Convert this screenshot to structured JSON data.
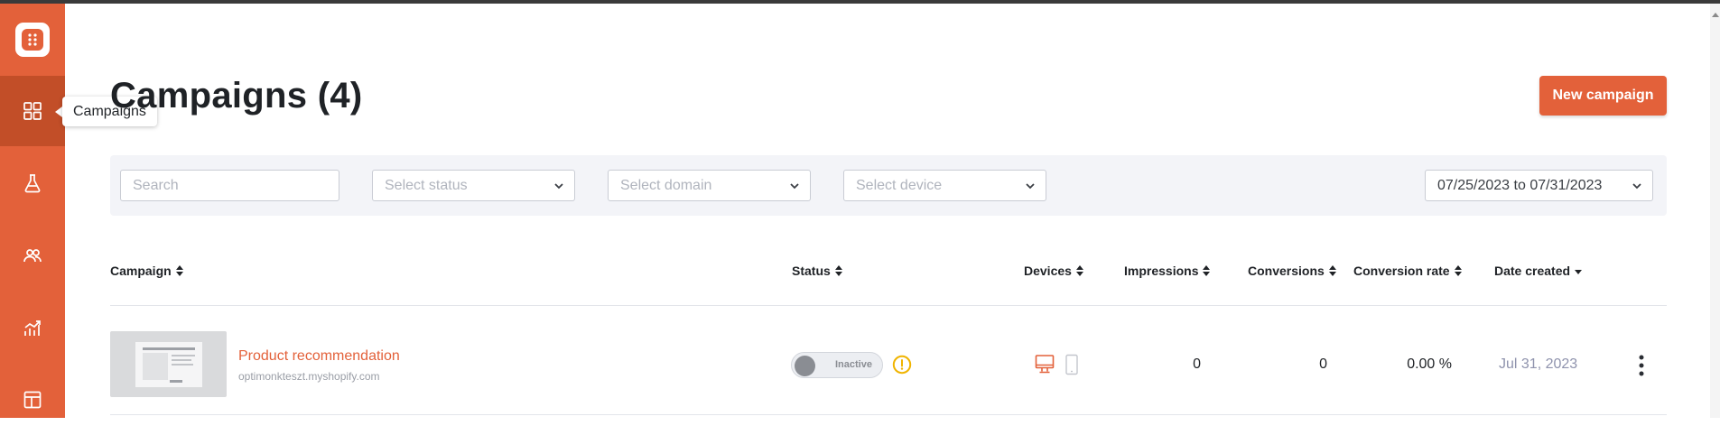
{
  "page": {
    "title": "Campaigns (4)",
    "new_campaign_label": "New campaign"
  },
  "sidebar": {
    "tooltip": "Campaigns",
    "items": [
      {
        "icon": "grid-icon",
        "active": true
      },
      {
        "icon": "flask-icon",
        "active": false
      },
      {
        "icon": "users-icon",
        "active": false
      },
      {
        "icon": "analytics-icon",
        "active": false
      },
      {
        "icon": "layout-icon",
        "active": false
      }
    ]
  },
  "filters": {
    "search_placeholder": "Search",
    "status_placeholder": "Select status",
    "domain_placeholder": "Select domain",
    "device_placeholder": "Select device",
    "date_range": "07/25/2023 to 07/31/2023"
  },
  "table": {
    "columns": {
      "campaign": "Campaign",
      "status": "Status",
      "devices": "Devices",
      "impressions": "Impressions",
      "conversions": "Conversions",
      "conversion_rate": "Conversion rate",
      "date_created": "Date created"
    },
    "rows": [
      {
        "name": "Product recommendation",
        "domain": "optimonkteszt.myshopify.com",
        "status": "Inactive",
        "impressions": "0",
        "conversions": "0",
        "conversion_rate": "0.00 %",
        "date_created": "Jul 31, 2023"
      }
    ]
  },
  "colors": {
    "accent": "#e3613a",
    "sidebar_active": "#c24e28",
    "warning": "#f0b400"
  }
}
